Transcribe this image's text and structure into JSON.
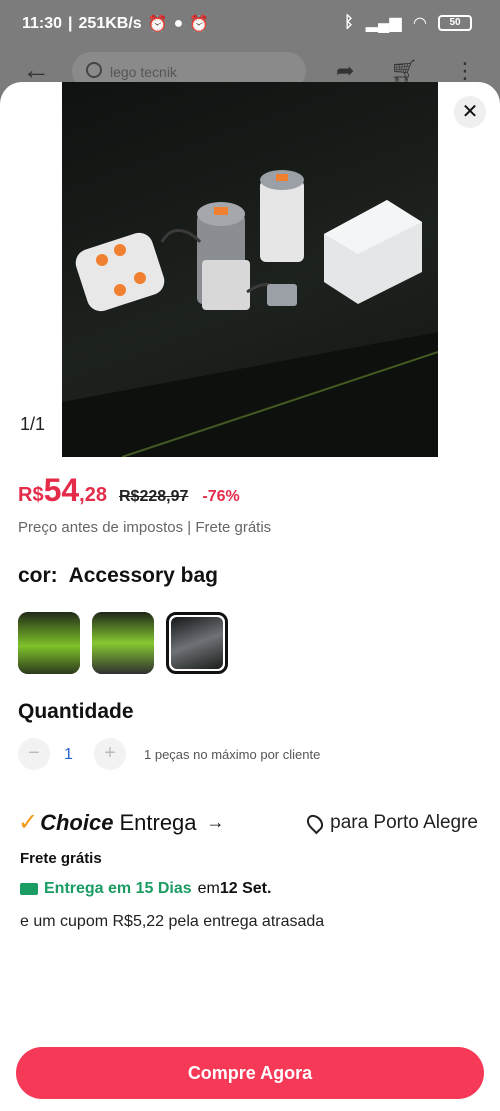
{
  "status_bar": {
    "time": "11:30",
    "speed": "251KB/s",
    "battery": "50"
  },
  "header": {
    "search_text": "lego tecnik"
  },
  "image": {
    "counter": "1/1"
  },
  "price": {
    "currency": "R$",
    "integer": "54",
    "decimal": ",28",
    "original": "R$228,97",
    "discount": "-76%"
  },
  "tax_note": "Preço antes de impostos | Frete grátis",
  "color": {
    "label": "cor:",
    "selected": "Accessory bag"
  },
  "quantity": {
    "title": "Quantidade",
    "value": "1",
    "note": "1 peças no máximo por cliente"
  },
  "shipping": {
    "brand": "Choice",
    "label": "Entrega",
    "destination": "para Porto Alegre",
    "free": "Frete grátis",
    "delivery_green": "Entrega em 15 Dias",
    "delivery_em": "em",
    "delivery_date": "12 Set.",
    "coupon": "e um cupom R$5,22 pela entrega atrasada"
  },
  "buy_button": "Compre Agora",
  "colors": {
    "accent": "#f53956",
    "price": "#e52b4a",
    "delivery": "#1a9c63",
    "choice_check": "#f39a16"
  }
}
